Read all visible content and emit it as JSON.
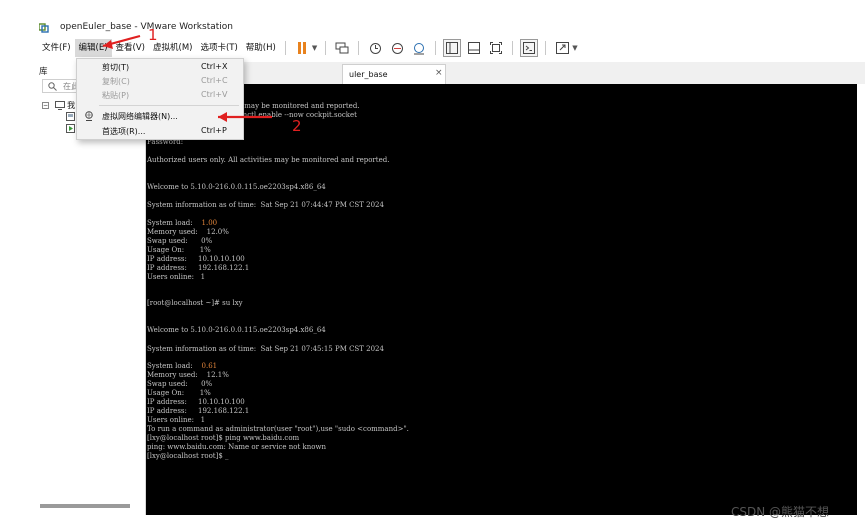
{
  "window": {
    "title": "openEuler_base - VMware Workstation",
    "app_icon": "vmware-icon"
  },
  "menu": {
    "items": [
      "文件(F)",
      "编辑(E)",
      "查看(V)",
      "虚拟机(M)",
      "选项卡(T)",
      "帮助(H)"
    ],
    "active_index": 1
  },
  "toolbar": {
    "icons": [
      "pause-icon",
      "send-ctrl-alt-del-icon",
      "snapshot-icon",
      "revert-snapshot-icon",
      "manage-snapshots-icon",
      "library-view-icon",
      "thumbnail-view-icon",
      "fit-guest-icon",
      "console-view-icon",
      "full-screen-icon"
    ],
    "accent": "#e8821e"
  },
  "sidebar": {
    "title": "库",
    "search_placeholder": "在此",
    "tree": [
      {
        "label": "我",
        "icon": "computer-icon"
      },
      {
        "label": "",
        "icon": "vm-icon"
      },
      {
        "label": "",
        "icon": "vm-running-icon"
      }
    ]
  },
  "tab": {
    "label": "uler_base",
    "close": "×"
  },
  "dropdown": {
    "items": [
      {
        "label": "剪切(T)",
        "shortcut": "Ctrl+X",
        "enabled": true
      },
      {
        "label": "复制(C)",
        "shortcut": "Ctrl+C",
        "enabled": false
      },
      {
        "label": "粘贴(P)",
        "shortcut": "Ctrl+V",
        "enabled": false
      },
      {
        "label": "虚拟网络编辑器(N)...",
        "shortcut": "",
        "enabled": true,
        "icon": "network-editor-icon"
      },
      {
        "label": "首选项(R)...",
        "shortcut": "Ctrl+P",
        "enabled": true
      }
    ]
  },
  "terminal": {
    "lines": [
      "                       All activities may be monitored and reported.",
      "                      e with: systemctl enable --now cockpit.socket",
      "",
      "",
      "Password:",
      "",
      "Authorized users only. All activities may be monitored and reported.",
      "",
      "",
      "Welcome to 5.10.0-216.0.0.115.oe2203sp4.x86_64",
      "",
      "System information as of time:  Sat Sep 21 07:44:47 PM CST 2024",
      "",
      "System load:    ",
      "Memory used:    12.0%",
      "Swap used:      0%",
      "Usage On:       1%",
      "IP address:     10.10.10.100",
      "IP address:     192.168.122.1",
      "Users online:   1",
      "",
      "",
      "[root@localhost ~]# su lxy",
      "",
      "",
      "Welcome to 5.10.0-216.0.0.115.oe2203sp4.x86_64",
      "",
      "System information as of time:  Sat Sep 21 07:45:15 PM CST 2024",
      "",
      "System load:    ",
      "Memory used:    12.1%",
      "Swap used:      0%",
      "Usage On:       1%",
      "IP address:     10.10.10.100",
      "IP address:     192.168.122.1",
      "Users online:   1",
      "To run a command as administrator(user \"root\"),use \"sudo <command>\".",
      "[lxy@localhost root]$ ping www.baidu.com",
      "ping: www.baidu.com: Name or service not known",
      "[lxy@localhost root]$ _"
    ],
    "system_load_1": "1.00",
    "system_load_2": "0.61",
    "highlight_color": "#e0843a"
  },
  "annotations": {
    "step1": "1",
    "step2": "2",
    "color": "#e02020"
  },
  "watermark": "CSDN @熊猫不想"
}
